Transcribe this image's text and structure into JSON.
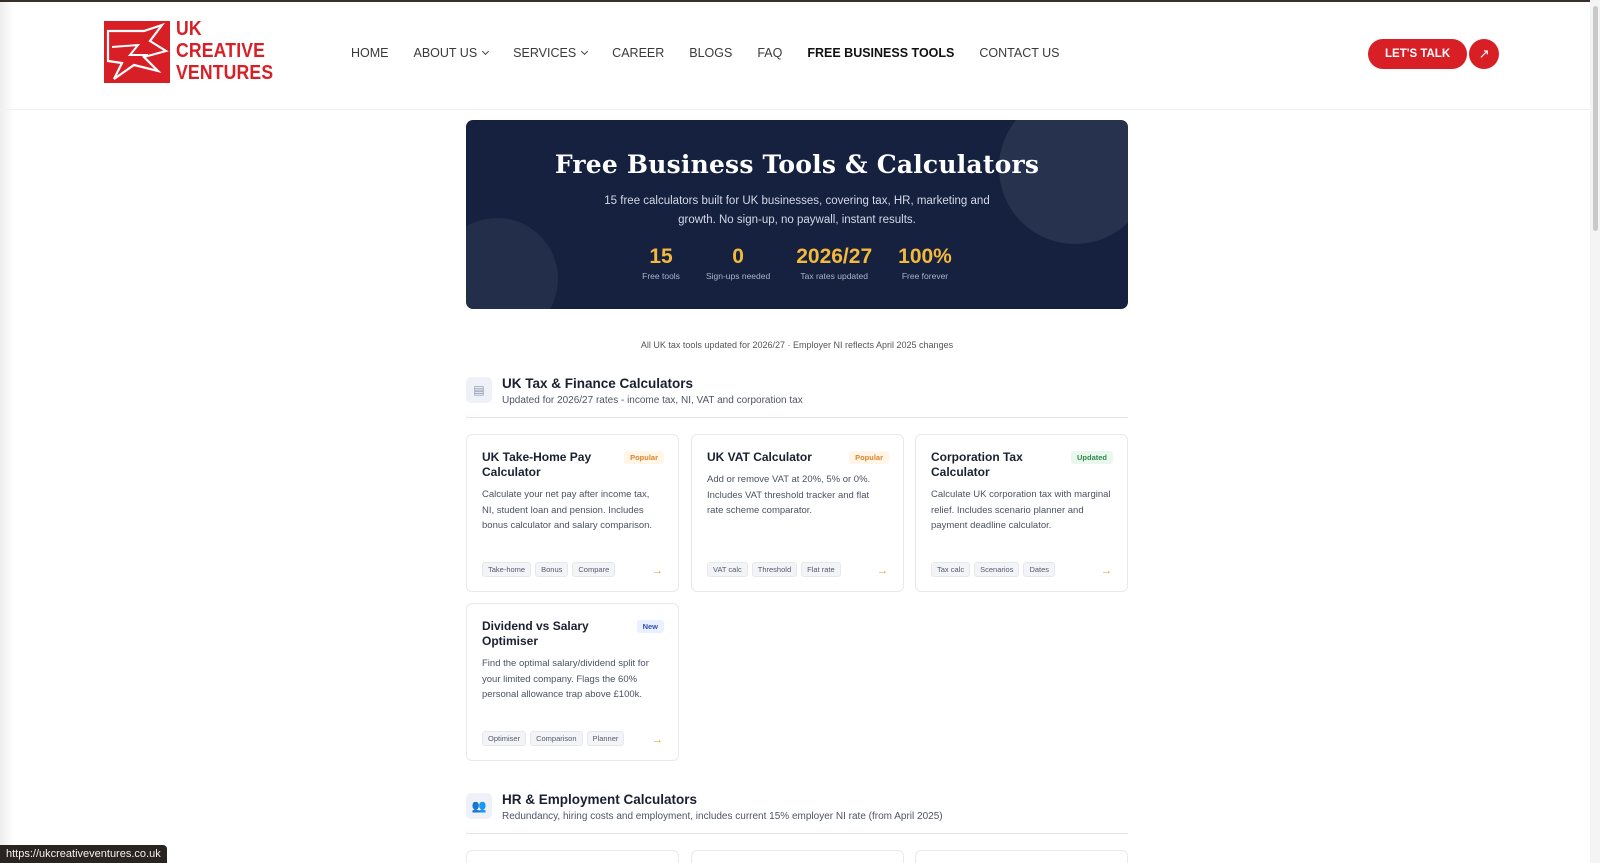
{
  "header": {
    "logo_lines": [
      "UK",
      "CREATIVE",
      "VENTURES"
    ],
    "nav": [
      {
        "label": "HOME",
        "dropdown": false,
        "active": false
      },
      {
        "label": "ABOUT US",
        "dropdown": true,
        "active": false
      },
      {
        "label": "SERVICES",
        "dropdown": true,
        "active": false
      },
      {
        "label": "CAREER",
        "dropdown": false,
        "active": false
      },
      {
        "label": "BLOGS",
        "dropdown": false,
        "active": false
      },
      {
        "label": "FAQ",
        "dropdown": false,
        "active": false
      },
      {
        "label": "FREE BUSINESS TOOLS",
        "dropdown": false,
        "active": true
      },
      {
        "label": "CONTACT US",
        "dropdown": false,
        "active": false
      }
    ],
    "cta_label": "LET'S TALK",
    "cta_icon": "arrow-up-right-icon"
  },
  "hero": {
    "title": "Free Business Tools & Calculators",
    "subtitle": "15 free calculators built for UK businesses, covering tax, HR, marketing and growth. No sign-up, no paywall, instant results.",
    "stats": [
      {
        "value": "15",
        "label": "Free tools"
      },
      {
        "value": "0",
        "label": "Sign-ups needed"
      },
      {
        "value": "2026/27",
        "label": "Tax rates updated"
      },
      {
        "value": "100%",
        "label": "Free forever"
      }
    ]
  },
  "note": "All UK tax tools updated for 2026/27 · Employer NI reflects April 2025 changes",
  "sections": [
    {
      "icon": "calculator-icon",
      "title": "UK Tax & Finance Calculators",
      "subtitle": "Updated for 2026/27 rates - income tax, NI, VAT and corporation tax",
      "cards": [
        {
          "title": "UK Take-Home Pay Calculator",
          "badge": "Popular",
          "badge_type": "popular",
          "desc": "Calculate your net pay after income tax, NI, student loan and pension. Includes bonus calculator and salary comparison.",
          "tags": [
            "Take-home",
            "Bonus",
            "Compare"
          ]
        },
        {
          "title": "UK VAT Calculator",
          "badge": "Popular",
          "badge_type": "popular",
          "desc": "Add or remove VAT at 20%, 5% or 0%. Includes VAT threshold tracker and flat rate scheme comparator.",
          "tags": [
            "VAT calc",
            "Threshold",
            "Flat rate"
          ]
        },
        {
          "title": "Corporation Tax Calculator",
          "badge": "Updated",
          "badge_type": "updated",
          "desc": "Calculate UK corporation tax with marginal relief. Includes scenario planner and payment deadline calculator.",
          "tags": [
            "Tax calc",
            "Scenarios",
            "Dates"
          ]
        },
        {
          "title": "Dividend vs Salary Optimiser",
          "badge": "New",
          "badge_type": "new",
          "desc": "Find the optimal salary/dividend split for your limited company. Flags the 60% personal allowance trap above £100k.",
          "tags": [
            "Optimiser",
            "Comparison",
            "Planner"
          ]
        }
      ]
    },
    {
      "icon": "people-icon",
      "title": "HR & Employment Calculators",
      "subtitle": "Redundancy, hiring costs and employment, includes current 15% employer NI rate (from April 2025)"
    }
  ],
  "status_bar_url": "https://ukcreativeventures.co.uk"
}
